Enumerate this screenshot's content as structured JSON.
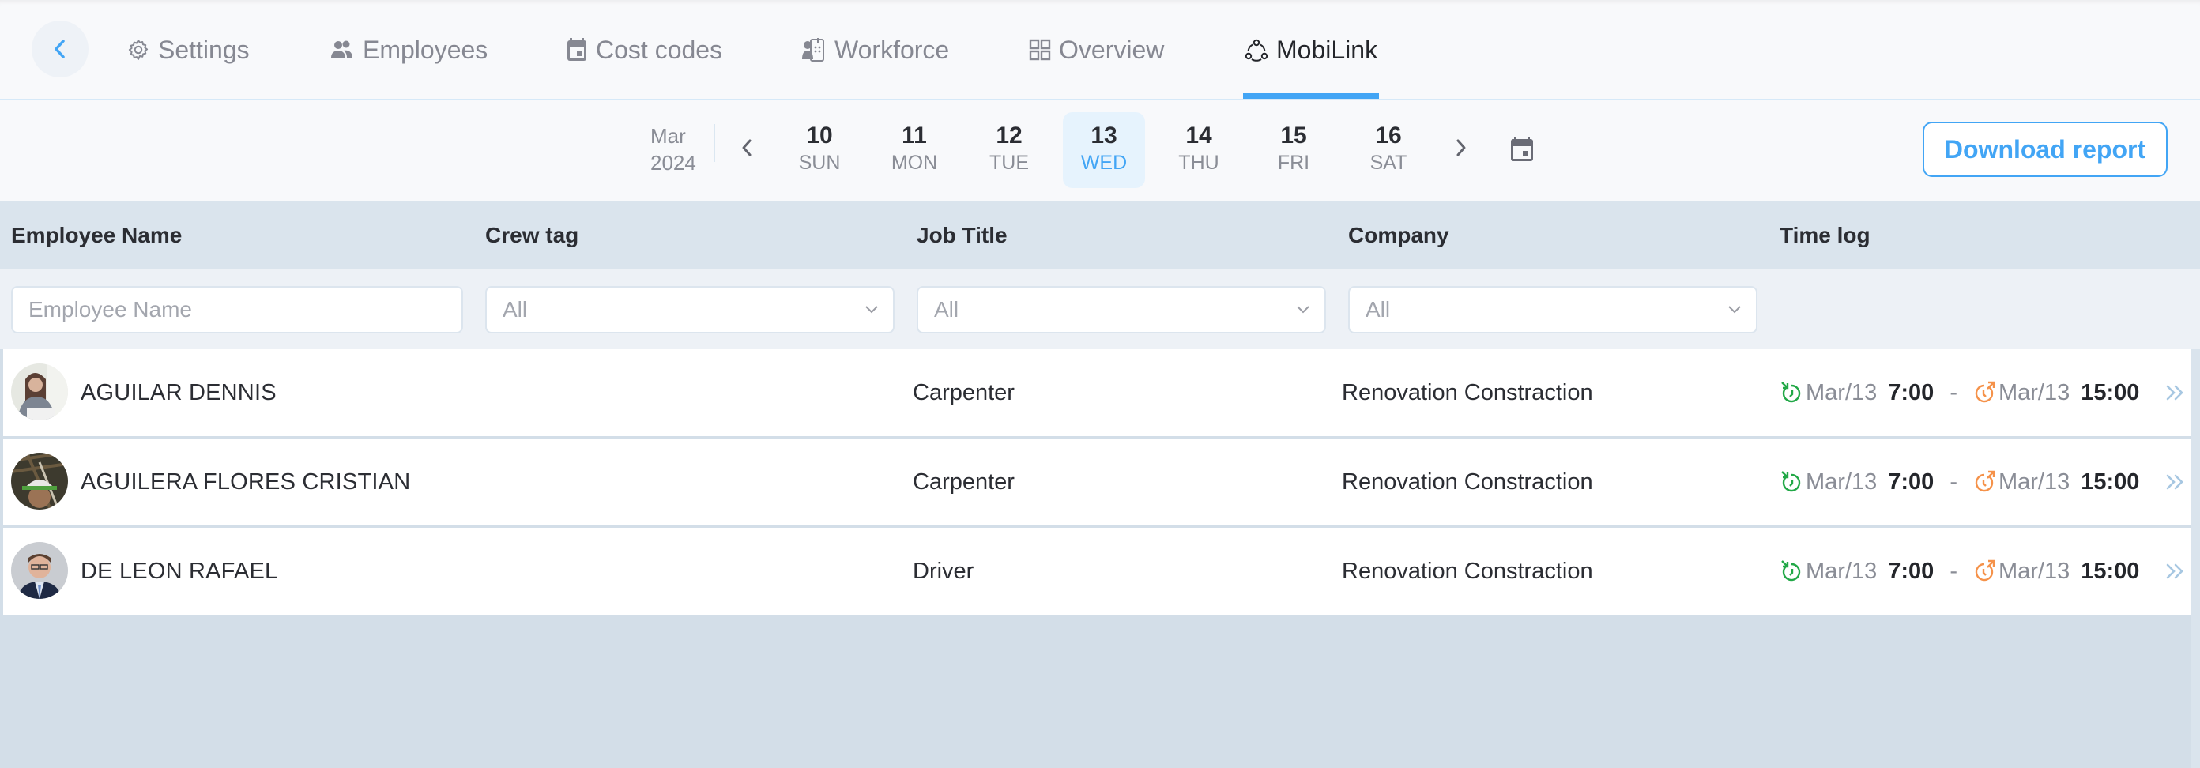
{
  "nav": {
    "back_icon": "chevron-left-icon",
    "items": [
      {
        "label": "Settings",
        "icon": "gear-icon",
        "active": false
      },
      {
        "label": "Employees",
        "icon": "people-icon",
        "active": false
      },
      {
        "label": "Cost codes",
        "icon": "calendar-icon",
        "active": false
      },
      {
        "label": "Workforce",
        "icon": "workforce-icon",
        "active": false
      },
      {
        "label": "Overview",
        "icon": "grid-icon",
        "active": false
      },
      {
        "label": "MobiLink",
        "icon": "share-nodes-icon",
        "active": true
      }
    ]
  },
  "datebar": {
    "month": "Mar",
    "year": "2024",
    "days": [
      {
        "num": "10",
        "name": "SUN",
        "selected": false
      },
      {
        "num": "11",
        "name": "MON",
        "selected": false
      },
      {
        "num": "12",
        "name": "TUE",
        "selected": false
      },
      {
        "num": "13",
        "name": "WED",
        "selected": true
      },
      {
        "num": "14",
        "name": "THU",
        "selected": false
      },
      {
        "num": "15",
        "name": "FRI",
        "selected": false
      },
      {
        "num": "16",
        "name": "SAT",
        "selected": false
      }
    ],
    "download_label": "Download report"
  },
  "table": {
    "columns": [
      "Employee Name",
      "Crew tag",
      "Job Title",
      "Company",
      "Time log"
    ],
    "filters": {
      "employee_name_placeholder": "Employee Name",
      "crew_tag": "All",
      "job_title": "All",
      "company": "All"
    },
    "rows": [
      {
        "name": "AGUILAR DENNIS",
        "crew_tag": "",
        "job_title": "Carpenter",
        "company": "Renovation Constraction",
        "clock_in_date": "Mar/13",
        "clock_in_time": "7:00",
        "clock_out_date": "Mar/13",
        "clock_out_time": "15:00"
      },
      {
        "name": "AGUILERA FLORES CRISTIAN",
        "crew_tag": "",
        "job_title": "Carpenter",
        "company": "Renovation Constraction",
        "clock_in_date": "Mar/13",
        "clock_in_time": "7:00",
        "clock_out_date": "Mar/13",
        "clock_out_time": "15:00"
      },
      {
        "name": "DE LEON RAFAEL",
        "crew_tag": "",
        "job_title": "Driver",
        "company": "Renovation Constraction",
        "clock_in_date": "Mar/13",
        "clock_in_time": "7:00",
        "clock_out_date": "Mar/13",
        "clock_out_time": "15:00"
      }
    ],
    "separator": "-"
  },
  "colors": {
    "accent": "#42a5f5",
    "clock_in": "#22a847",
    "clock_out": "#f5924a"
  }
}
